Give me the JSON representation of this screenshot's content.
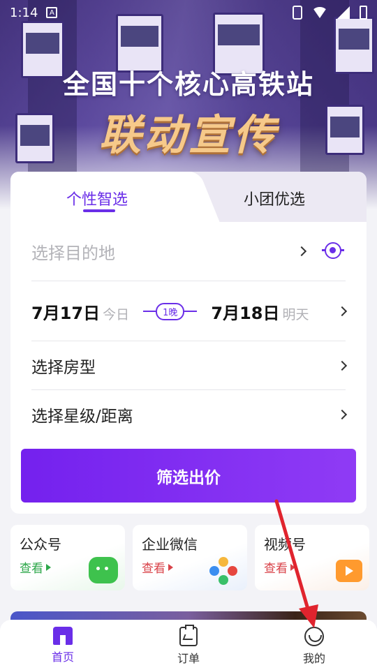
{
  "status_bar": {
    "time": "1:14",
    "a_badge": "A"
  },
  "hero": {
    "headline": "全国十个核心高铁站",
    "slogan": "联动宣传"
  },
  "search": {
    "tabs": [
      {
        "label": "个性智选",
        "active": true
      },
      {
        "label": "小团优选",
        "active": false
      }
    ],
    "destination_placeholder": "选择目的地",
    "checkin_date": "7月17日",
    "checkin_day": "今日",
    "nights": "1晚",
    "checkout_date": "7月18日",
    "checkout_day": "明天",
    "room_type": "选择房型",
    "star_distance": "选择星级/距离",
    "submit_label": "筛选出价"
  },
  "social": [
    {
      "title": "公众号",
      "link": "查看",
      "icon": "wechat-icon",
      "link_color": "#2da74a"
    },
    {
      "title": "企业微信",
      "link": "查看",
      "icon": "wework-icon",
      "link_color": "#d9434a"
    },
    {
      "title": "视频号",
      "link": "查看",
      "icon": "video-channel-icon",
      "link_color": "#d9434a"
    }
  ],
  "nav": [
    {
      "label": "首页",
      "icon": "home-icon",
      "active": true
    },
    {
      "label": "订单",
      "icon": "order-icon",
      "active": false
    },
    {
      "label": "我的",
      "icon": "profile-icon",
      "active": false
    }
  ],
  "colors": {
    "accent": "#6a2ee8",
    "button_gradient_start": "#7421ee",
    "button_gradient_end": "#8f3bf5",
    "annotation_arrow": "#e0242e"
  }
}
